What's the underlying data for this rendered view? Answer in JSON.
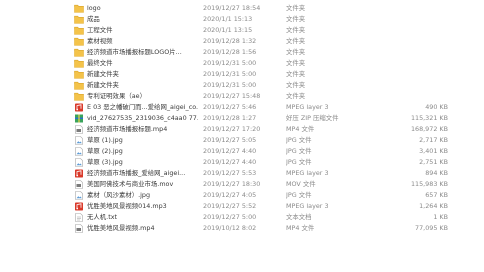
{
  "files": [
    {
      "name": "logo",
      "date": "2019/12/27 18:54",
      "type": "文件夹",
      "size": "",
      "icon": "folder-icon"
    },
    {
      "name": "成品",
      "date": "2020/1/1 15:13",
      "type": "文件夹",
      "size": "",
      "icon": "folder-icon"
    },
    {
      "name": "工程文件",
      "date": "2020/1/1 13:15",
      "type": "文件夹",
      "size": "",
      "icon": "folder-icon"
    },
    {
      "name": "素材视频",
      "date": "2019/12/28 1:32",
      "type": "文件夹",
      "size": "",
      "icon": "folder-icon"
    },
    {
      "name": "经济频道市场播报标题LOGO片...",
      "date": "2019/12/28 1:56",
      "type": "文件夹",
      "size": "",
      "icon": "folder-icon"
    },
    {
      "name": "最终文件",
      "date": "2019/12/31 5:00",
      "type": "文件夹",
      "size": "",
      "icon": "folder-icon"
    },
    {
      "name": "新建文件夹",
      "date": "2019/12/31 5:00",
      "type": "文件夹",
      "size": "",
      "icon": "folder-icon"
    },
    {
      "name": "新建文件夹",
      "date": "2019/12/31 5:00",
      "type": "文件夹",
      "size": "",
      "icon": "folder-icon"
    },
    {
      "name": "专利证明效果（ae）",
      "date": "2019/12/27 15:48",
      "type": "文件夹",
      "size": "",
      "icon": "folder-icon"
    },
    {
      "name": "E 03 恶之幡破门而...爱给网_aigei_co...",
      "date": "2019/12/27 5:46",
      "type": "MPEG layer 3",
      "size": "490 KB",
      "icon": "audio-file-icon"
    },
    {
      "name": "vid_27627535_2319036_c4aa0 77...",
      "date": "2019/12/28 1:27",
      "type": "好压 ZIP 压缩文件",
      "size": "115,321 KB",
      "icon": "zip-file-icon"
    },
    {
      "name": "经济频道市场播报标题.mp4",
      "date": "2019/12/27 17:20",
      "type": "MP4 文件",
      "size": "168,972 KB",
      "icon": "video-file-icon"
    },
    {
      "name": "草原 (1).jpg",
      "date": "2019/12/27 5:05",
      "type": "JPG 文件",
      "size": "2,717 KB",
      "icon": "image-file-icon"
    },
    {
      "name": "草原 (2).jpg",
      "date": "2019/12/27 4:40",
      "type": "JPG 文件",
      "size": "3,401 KB",
      "icon": "image-file-icon"
    },
    {
      "name": "草原 (3).jpg",
      "date": "2019/12/27 4:40",
      "type": "JPG 文件",
      "size": "2,751 KB",
      "icon": "image-file-icon"
    },
    {
      "name": "经济频道市场播报_爱给网_aigei...",
      "date": "2019/12/27 5:53",
      "type": "MPEG layer 3",
      "size": "894 KB",
      "icon": "audio-file-icon"
    },
    {
      "name": "美国阿佛技术与商业市场.mov",
      "date": "2019/12/27 18:30",
      "type": "MOV 文件",
      "size": "115,983 KB",
      "icon": "video-file-icon"
    },
    {
      "name": "素材（风沙素材）.jpg",
      "date": "2019/12/27 4:05",
      "type": "JPG 文件",
      "size": "657 KB",
      "icon": "image-file-icon"
    },
    {
      "name": "优胜美地风景视频014.mp3",
      "date": "2019/12/27 5:52",
      "type": "MPEG layer 3",
      "size": "1,264 KB",
      "icon": "audio-file-icon"
    },
    {
      "name": "无人机.txt",
      "date": "2019/12/27 5:00",
      "type": "文本文档",
      "size": "1 KB",
      "icon": "text-file-icon"
    },
    {
      "name": "优胜美地风景视频.mp4",
      "date": "2019/10/12 8:02",
      "type": "MP4 文件",
      "size": "77,095 KB",
      "icon": "video-file-icon"
    }
  ],
  "colors": {
    "folder": "#f4c34a",
    "folder_dark": "#d9a52c",
    "audio": "#d93a2b",
    "zip": "#3aa35b",
    "file_border": "#a8a8a8"
  }
}
